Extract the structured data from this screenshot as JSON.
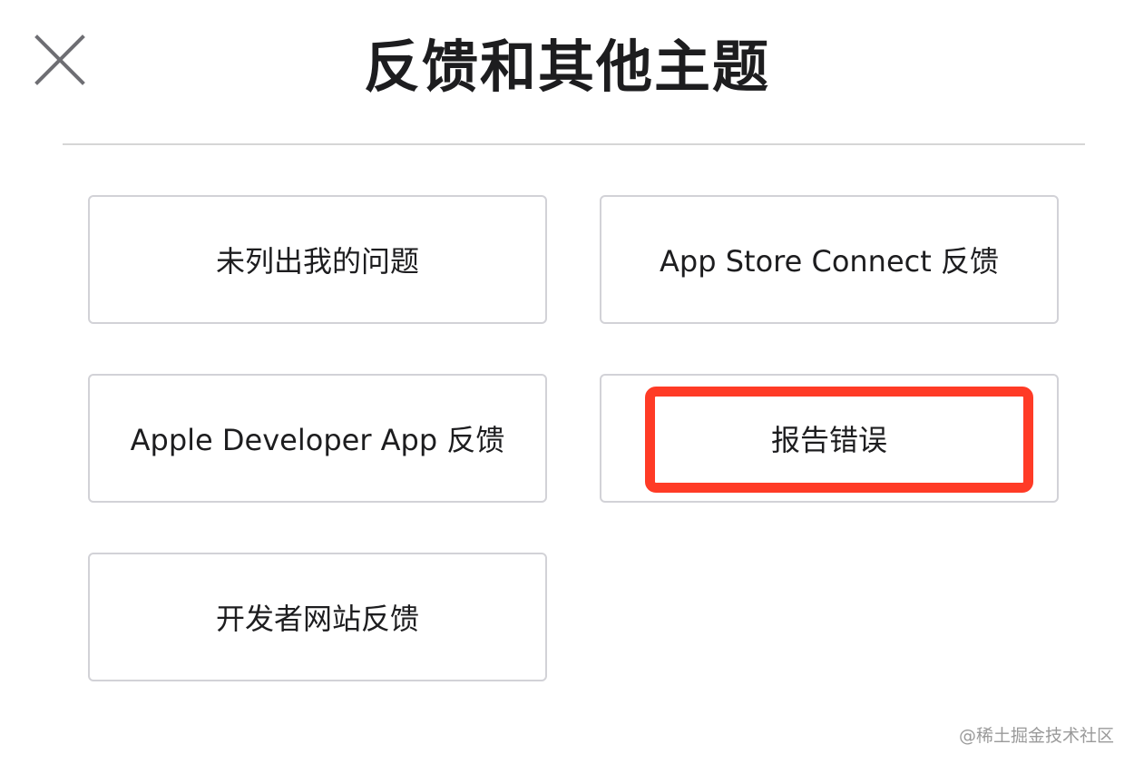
{
  "header": {
    "title": "反馈和其他主题",
    "close_icon": "close-icon"
  },
  "options": [
    {
      "label": "未列出我的问题"
    },
    {
      "label": "App Store Connect 反馈"
    },
    {
      "label": "Apple Developer App 反馈"
    },
    {
      "label": "报告错误"
    },
    {
      "label": "开发者网站反馈"
    }
  ],
  "highlight": {
    "target": "报告错误",
    "color": "#ff3b26"
  },
  "watermark": {
    "text": "@稀土掘金技术社区"
  }
}
